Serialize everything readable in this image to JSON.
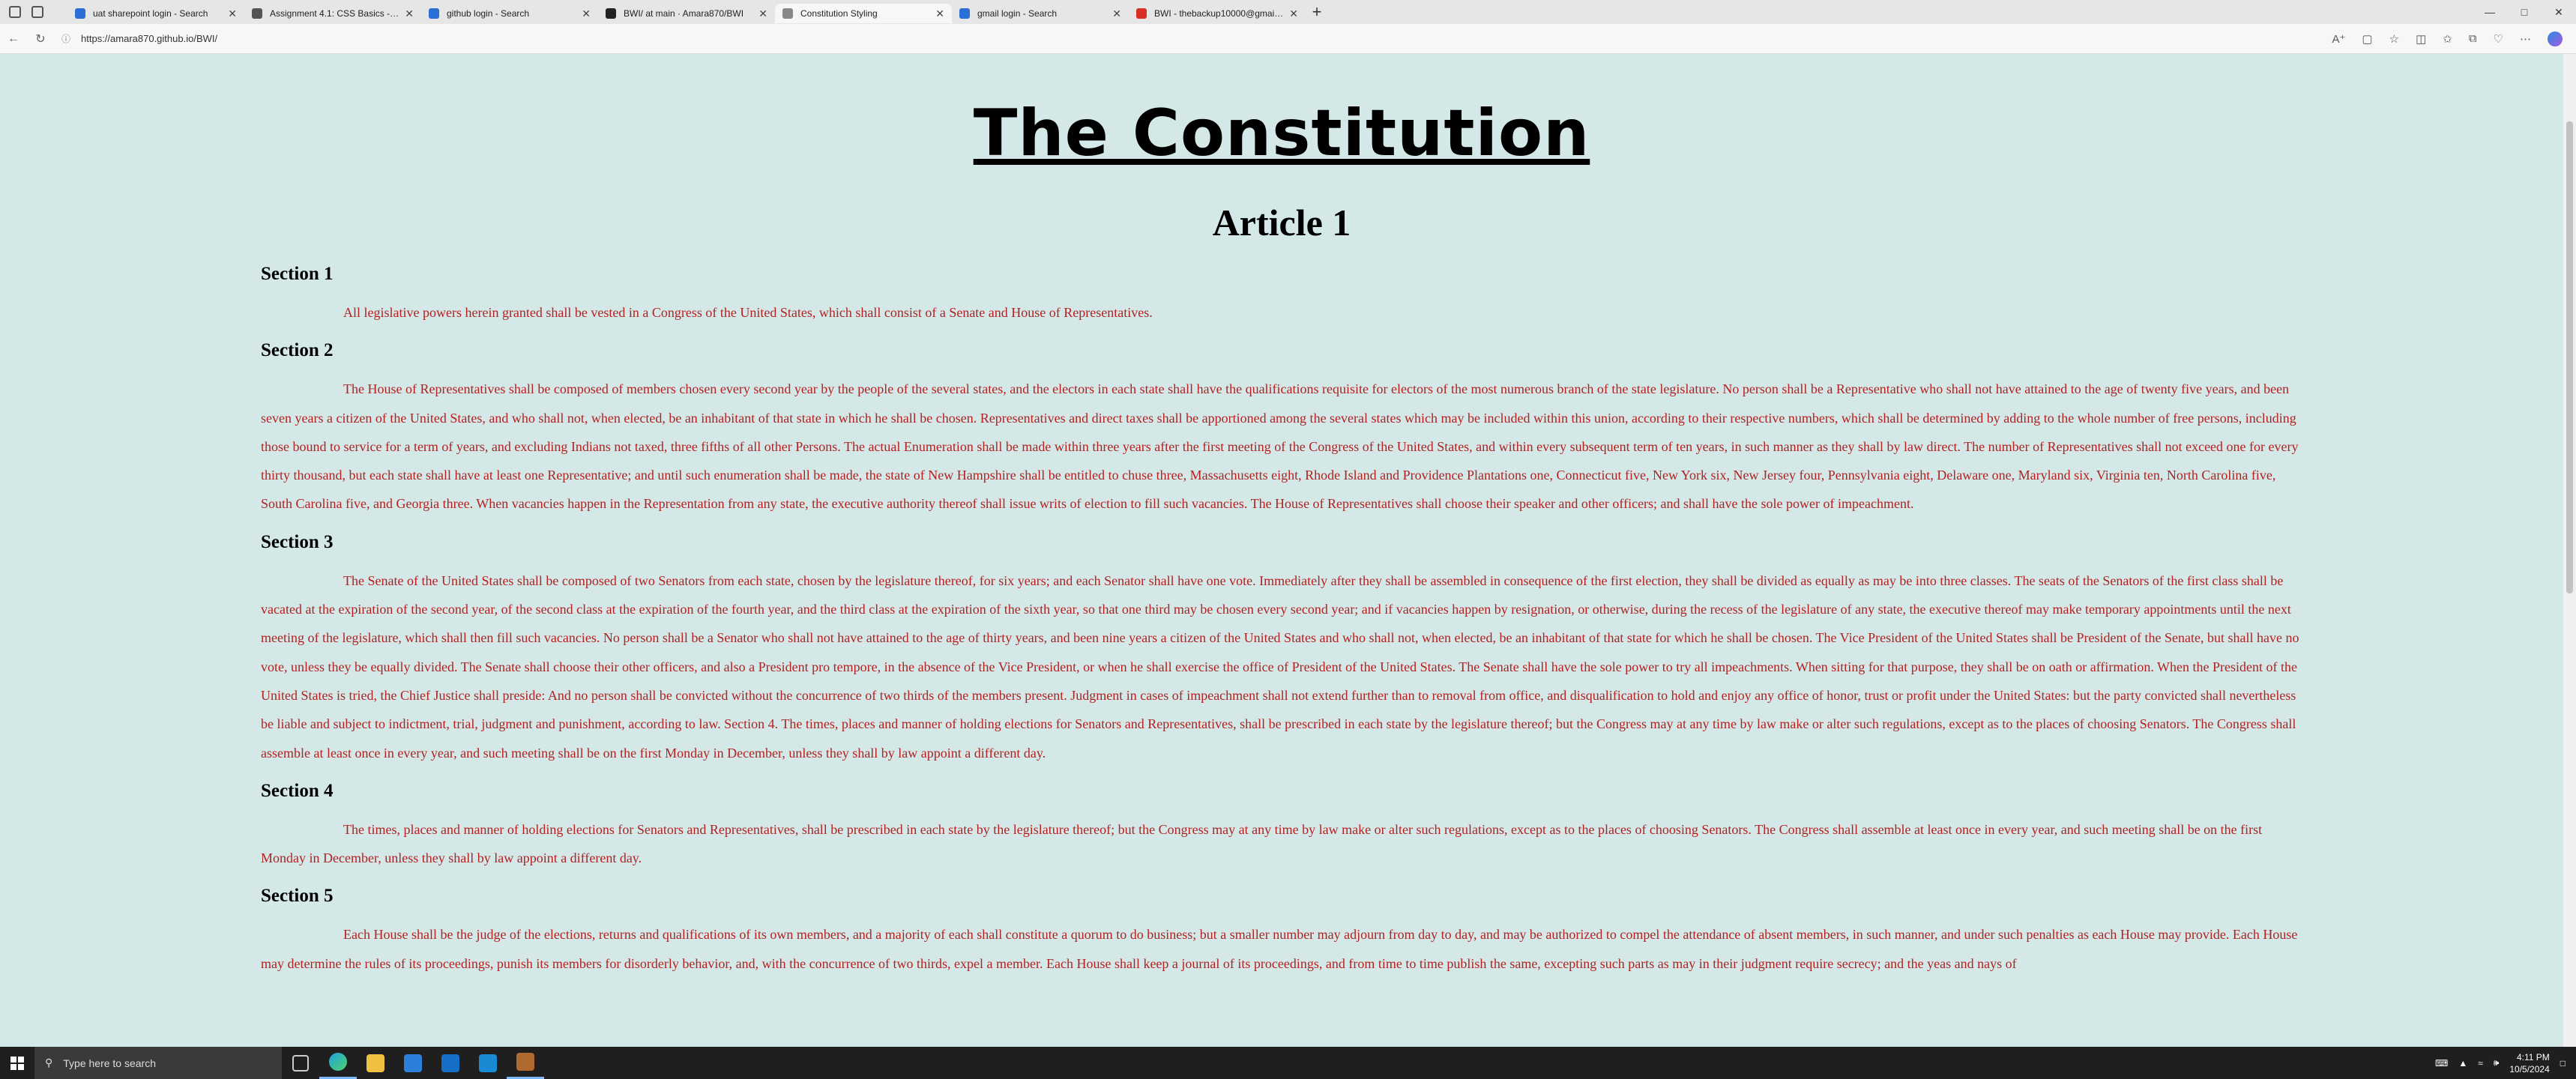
{
  "browser": {
    "tabs": [
      {
        "title": "uat sharepoint login - Search",
        "color": "#2a6fd6",
        "active": false
      },
      {
        "title": "Assignment 4.1: CSS Basics - Text",
        "color": "#555555",
        "active": false
      },
      {
        "title": "github login - Search",
        "color": "#2a6fd6",
        "active": false
      },
      {
        "title": "BWI/ at main · Amara870/BWI",
        "color": "#222222",
        "active": false
      },
      {
        "title": "Constitution Styling",
        "color": "#888888",
        "active": true
      },
      {
        "title": "gmail login - Search",
        "color": "#2a6fd6",
        "active": false
      },
      {
        "title": "BWI - thebackup10000@gmail.com",
        "color": "#d93025",
        "active": false
      }
    ],
    "url": "https://amara870.github.io/BWI/"
  },
  "page": {
    "title": "The Constitution",
    "article": "Article 1",
    "sections": [
      {
        "heading": "Section 1",
        "text": "All legislative powers herein granted shall be vested in a Congress of the United States, which shall consist of a Senate and House of Representatives."
      },
      {
        "heading": "Section 2",
        "text": "The House of Representatives shall be composed of members chosen every second year by the people of the several states, and the electors in each state shall have the qualifications requisite for electors of the most numerous branch of the state legislature. No person shall be a Representative who shall not have attained to the age of twenty five years, and been seven years a citizen of the United States, and who shall not, when elected, be an inhabitant of that state in which he shall be chosen. Representatives and direct taxes shall be apportioned among the several states which may be included within this union, according to their respective numbers, which shall be determined by adding to the whole number of free persons, including those bound to service for a term of years, and excluding Indians not taxed, three fifths of all other Persons. The actual Enumeration shall be made within three years after the first meeting of the Congress of the United States, and within every subsequent term of ten years, in such manner as they shall by law direct. The number of Representatives shall not exceed one for every thirty thousand, but each state shall have at least one Representative; and until such enumeration shall be made, the state of New Hampshire shall be entitled to chuse three, Massachusetts eight, Rhode Island and Providence Plantations one, Connecticut five, New York six, New Jersey four, Pennsylvania eight, Delaware one, Maryland six, Virginia ten, North Carolina five, South Carolina five, and Georgia three. When vacancies happen in the Representation from any state, the executive authority thereof shall issue writs of election to fill such vacancies. The House of Representatives shall choose their speaker and other officers; and shall have the sole power of impeachment."
      },
      {
        "heading": "Section 3",
        "text": "The Senate of the United States shall be composed of two Senators from each state, chosen by the legislature thereof, for six years; and each Senator shall have one vote. Immediately after they shall be assembled in consequence of the first election, they shall be divided as equally as may be into three classes. The seats of the Senators of the first class shall be vacated at the expiration of the second year, of the second class at the expiration of the fourth year, and the third class at the expiration of the sixth year, so that one third may be chosen every second year; and if vacancies happen by resignation, or otherwise, during the recess of the legislature of any state, the executive thereof may make temporary appointments until the next meeting of the legislature, which shall then fill such vacancies. No person shall be a Senator who shall not have attained to the age of thirty years, and been nine years a citizen of the United States and who shall not, when elected, be an inhabitant of that state for which he shall be chosen. The Vice President of the United States shall be President of the Senate, but shall have no vote, unless they be equally divided. The Senate shall choose their other officers, and also a President pro tempore, in the absence of the Vice President, or when he shall exercise the office of President of the United States. The Senate shall have the sole power to try all impeachments. When sitting for that purpose, they shall be on oath or affirmation. When the President of the United States is tried, the Chief Justice shall preside: And no person shall be convicted without the concurrence of two thirds of the members present. Judgment in cases of impeachment shall not extend further than to removal from office, and disqualification to hold and enjoy any office of honor, trust or profit under the United States: but the party convicted shall nevertheless be liable and subject to indictment, trial, judgment and punishment, according to law. Section 4. The times, places and manner of holding elections for Senators and Representatives, shall be prescribed in each state by the legislature thereof; but the Congress may at any time by law make or alter such regulations, except as to the places of choosing Senators. The Congress shall assemble at least once in every year, and such meeting shall be on the first Monday in December, unless they shall by law appoint a different day."
      },
      {
        "heading": "Section 4",
        "text": "The times, places and manner of holding elections for Senators and Representatives, shall be prescribed in each state by the legislature thereof; but the Congress may at any time by law make or alter such regulations, except as to the places of choosing Senators. The Congress shall assemble at least once in every year, and such meeting shall be on the first Monday in December, unless they shall by law appoint a different day."
      },
      {
        "heading": "Section 5",
        "text": "Each House shall be the judge of the elections, returns and qualifications of its own members, and a majority of each shall constitute a quorum to do business; but a smaller number may adjourn from day to day, and may be authorized to compel the attendance of absent members, in such manner, and under such penalties as each House may provide. Each House may determine the rules of its proceedings, punish its members for disorderly behavior, and, with the concurrence of two thirds, expel a member. Each House shall keep a journal of its proceedings, and from time to time publish the same, excepting such parts as may in their judgment require secrecy; and the yeas and nays of"
      }
    ]
  },
  "taskbar": {
    "search_placeholder": "Type here to search",
    "time": "4:11 PM",
    "date": "10/5/2024"
  }
}
